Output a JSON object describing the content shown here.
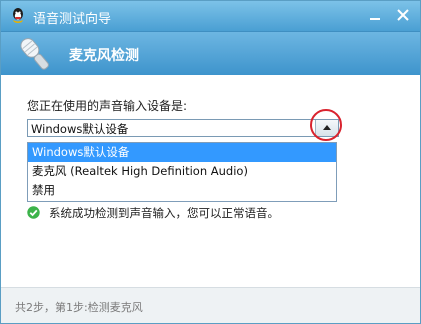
{
  "window": {
    "title": "语音测试向导",
    "minimize_symbol": "—",
    "close_symbol": "✕"
  },
  "header": {
    "title": "麦克风检测",
    "icon": "microphone-icon"
  },
  "body": {
    "prompt": "您正在使用的声音输入设备是:",
    "select": {
      "value": "Windows默认设备",
      "state": "expanded"
    },
    "options": [
      {
        "label": "Windows默认设备",
        "selected": true
      },
      {
        "label": "麦克风 (Realtek High Definition Audio)",
        "selected": false
      },
      {
        "label": "禁用",
        "selected": false
      }
    ],
    "status": {
      "text": "系统成功检测到声音输入，您可以正常语音。",
      "icon": "check-circle-icon",
      "color": "#3cb34a"
    }
  },
  "footer": {
    "text": "共2步，第1步:检测麦克风"
  },
  "colors": {
    "titlebar": "#4a9fd3",
    "header": "#3e94cc",
    "selection": "#3399ff",
    "highlight_circle": "#d9232e"
  }
}
